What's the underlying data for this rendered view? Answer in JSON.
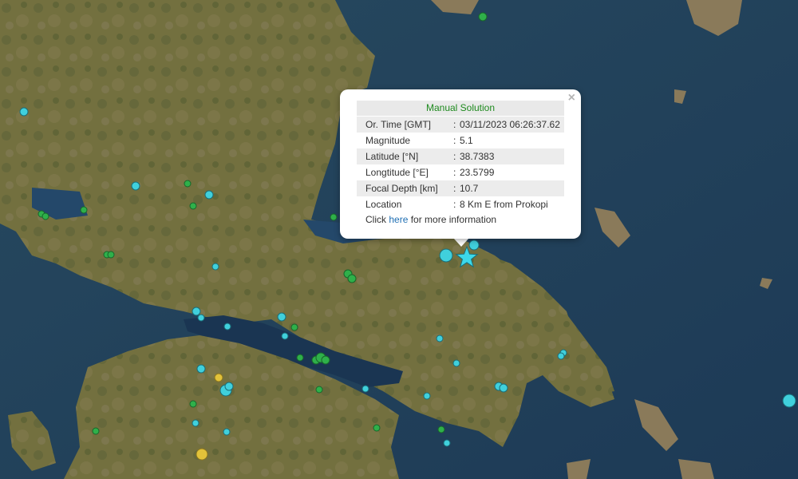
{
  "popup": {
    "title": "Manual Solution",
    "rows": [
      {
        "label": "Or. Time [GMT]",
        "value": "03/11/2023 06:26:37.62"
      },
      {
        "label": "Magnitude",
        "value": "5.1"
      },
      {
        "label": "Latitude [°N]",
        "value": "38.7383"
      },
      {
        "label": "Longtitude [°E]",
        "value": "23.5799"
      },
      {
        "label": "Focal Depth [km]",
        "value": "10.7"
      },
      {
        "label": "Location",
        "value": "8 Km E from Prokopi"
      }
    ],
    "separator": ":",
    "more_prefix": "Click ",
    "more_link": "here",
    "more_suffix": " for more information",
    "close_symbol": "×"
  },
  "colors": {
    "sea": "#1f3e5a",
    "land": "#6f6a43",
    "marker_cyan": "#40d0dc",
    "marker_green": "#2fb04a",
    "marker_yellow": "#e2c23a",
    "star": "#3cd8ea",
    "popup_title_green": "#1e8a1e",
    "link_blue": "#1f6fb3"
  },
  "icons": {
    "main_event": "star-icon",
    "close": "close-icon"
  }
}
